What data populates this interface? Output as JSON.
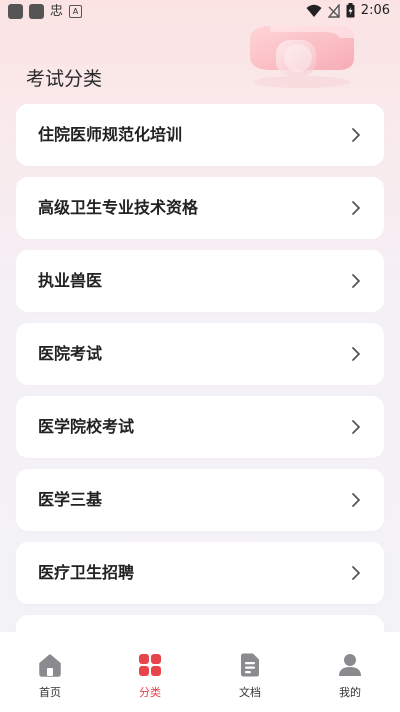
{
  "status_bar": {
    "left_glyph": "忠",
    "left_badge": "A",
    "time": "2:06",
    "icons": [
      "wifi-icon",
      "signal-off-icon",
      "battery-icon"
    ]
  },
  "header": {
    "title": "考试分类"
  },
  "categories": [
    {
      "label": "住院医师规范化培训"
    },
    {
      "label": "高级卫生专业技术资格"
    },
    {
      "label": "执业兽医"
    },
    {
      "label": "医院考试"
    },
    {
      "label": "医学院校考试"
    },
    {
      "label": "医学三基"
    },
    {
      "label": "医疗卫生招聘"
    }
  ],
  "bottom_nav": {
    "items": [
      {
        "label": "首页",
        "icon": "home-icon"
      },
      {
        "label": "分类",
        "icon": "category-grid-icon",
        "active": true
      },
      {
        "label": "文档",
        "icon": "document-icon"
      },
      {
        "label": "我的",
        "icon": "user-icon"
      }
    ]
  },
  "colors": {
    "accent": "#e8444b",
    "nav_icon_inactive": "#8a8a8f",
    "chevron": "#555555"
  }
}
